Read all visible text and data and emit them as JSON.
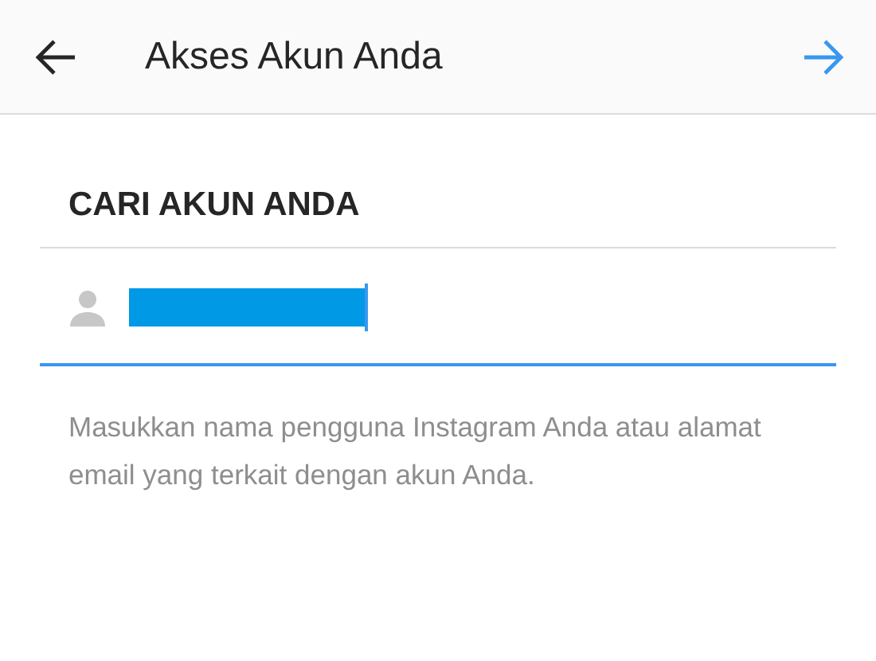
{
  "header": {
    "title": "Akses Akun Anda"
  },
  "section_title": "CARI AKUN ANDA",
  "username_field": {
    "focused": true
  },
  "help_text": "Masukkan nama pengguna Instagram Anda atau alamat email yang terkait dengan akun Anda."
}
